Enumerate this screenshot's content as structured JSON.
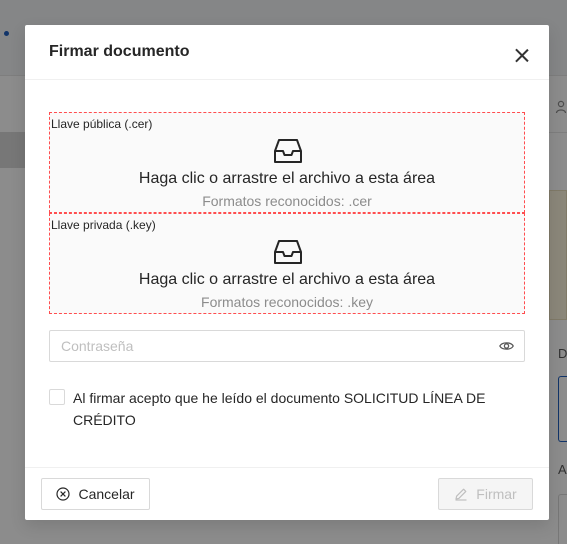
{
  "background": {
    "letter_d": "D",
    "letter_a": "A"
  },
  "modal": {
    "title": "Firmar documento",
    "dropzones": [
      {
        "label": "Llave pública (.cer)",
        "text": "Haga clic o arrastre el archivo a esta área",
        "hint": "Formatos reconocidos: .cer"
      },
      {
        "label": "Llave privada (.key)",
        "text": "Haga clic o arrastre el archivo a esta área",
        "hint": "Formatos reconocidos: .key"
      }
    ],
    "password": {
      "placeholder": "Contraseña",
      "value": ""
    },
    "agreement": {
      "checked": false,
      "text": "Al firmar acepto que he leído el documento SOLICITUD LÍNEA DE CRÉDITO"
    },
    "footer": {
      "cancel_label": "Cancelar",
      "sign_label": "Firmar"
    }
  },
  "icons": {
    "close": "close-icon",
    "inbox": "inbox-icon",
    "eye": "eye-icon",
    "cancel": "close-circle-icon",
    "sign": "pen-icon"
  },
  "colors": {
    "dropzone_border": "#ff4d4f",
    "disabled_text": "#bfbfbf",
    "accent": "#1f5fbf"
  }
}
